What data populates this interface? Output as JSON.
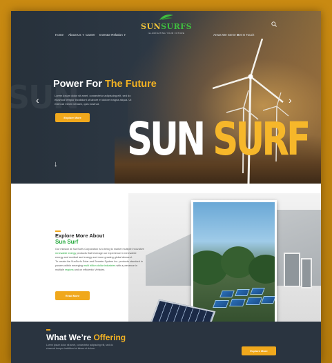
{
  "nav": {
    "left": [
      "Home",
      "About Us",
      "Career",
      "Investor Relation"
    ],
    "right": [
      "Areas We Serve",
      "Get In Touch"
    ]
  },
  "logo": {
    "brand_a": "SUN",
    "brand_b": "SURFS",
    "tagline": "ILLUMINATING YOUR FUTURE"
  },
  "hero": {
    "ghost": "SUN",
    "title_a": "Power For",
    "title_b": "The Future",
    "body": "Lorem ipsum dolor sit amet, consectetur adipiscing elit, sed do eiusmod tempor incididunt ut labore et dolore magna aliqua. Ut enim ad minim veniam, quis nostrud.",
    "button": "Explore More",
    "big_a": "SUN",
    "big_b": "SURF"
  },
  "about": {
    "kicker": "Explore More About",
    "title": "Sun Surf",
    "body_1": "Our mission at SunSurfs Corporation is to bring to market multiple innovative",
    "body_hl1": "renewable energy",
    "body_2": "products that leverage our experience in renewable energy and medical and energy and more growing global demand.",
    "body_3": "To create the SunSurfs Solar and Smarter System Inc. products standard in powers within emerging",
    "body_hl2": "multi billion dollar industries",
    "body_4": "with a presence in multiple",
    "body_hl3": "regions",
    "body_5": "and on efficientic Vehicles.",
    "button": "Read More"
  },
  "offer": {
    "title_a": "What We’re",
    "title_b": "Offering",
    "body": "Lorem ipsum dolor sit amet, consectetur adipiscing elit, sed do eiusmod tempor incididunt ut labore et dolore.",
    "button": "Explore More"
  },
  "colors": {
    "accent": "#f0a81c",
    "green": "#22a83a",
    "dark": "#2d3640"
  }
}
